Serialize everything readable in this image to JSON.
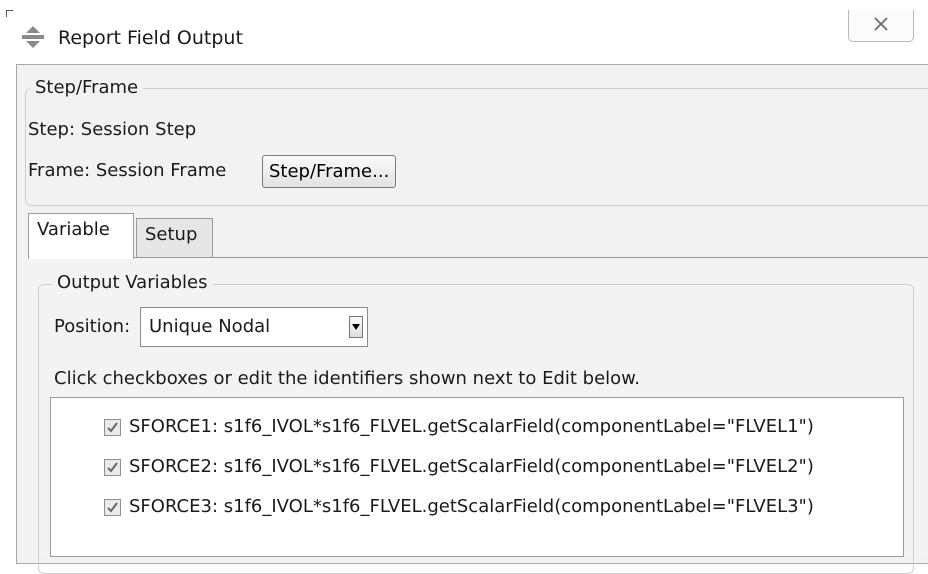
{
  "window": {
    "title": "Report Field Output",
    "close_glyph": "✕"
  },
  "step_frame": {
    "group_title": "Step/Frame",
    "step_label": "Step: Session Step",
    "frame_label": "Frame:  Session Frame",
    "button_label": "Step/Frame..."
  },
  "tabs": [
    {
      "label": "Variable",
      "active": true
    },
    {
      "label": "Setup",
      "active": false
    }
  ],
  "output_variables": {
    "group_title": "Output Variables",
    "position_label": "Position:",
    "position_value": "Unique Nodal",
    "hint": "Click checkboxes or edit the identifiers shown next to Edit below.",
    "items": [
      {
        "label": "SFORCE1: s1f6_IVOL*s1f6_FLVEL.getScalarField(componentLabel=\"FLVEL1\")",
        "checked": true
      },
      {
        "label": "SFORCE2: s1f6_IVOL*s1f6_FLVEL.getScalarField(componentLabel=\"FLVEL2\")",
        "checked": true
      },
      {
        "label": "SFORCE3: s1f6_IVOL*s1f6_FLVEL.getScalarField(componentLabel=\"FLVEL3\")",
        "checked": true
      }
    ]
  },
  "colors": {
    "dialog_bg": "#f2f2f2",
    "border": "#9a9a9a",
    "app_icon": "#8a8a8a"
  }
}
